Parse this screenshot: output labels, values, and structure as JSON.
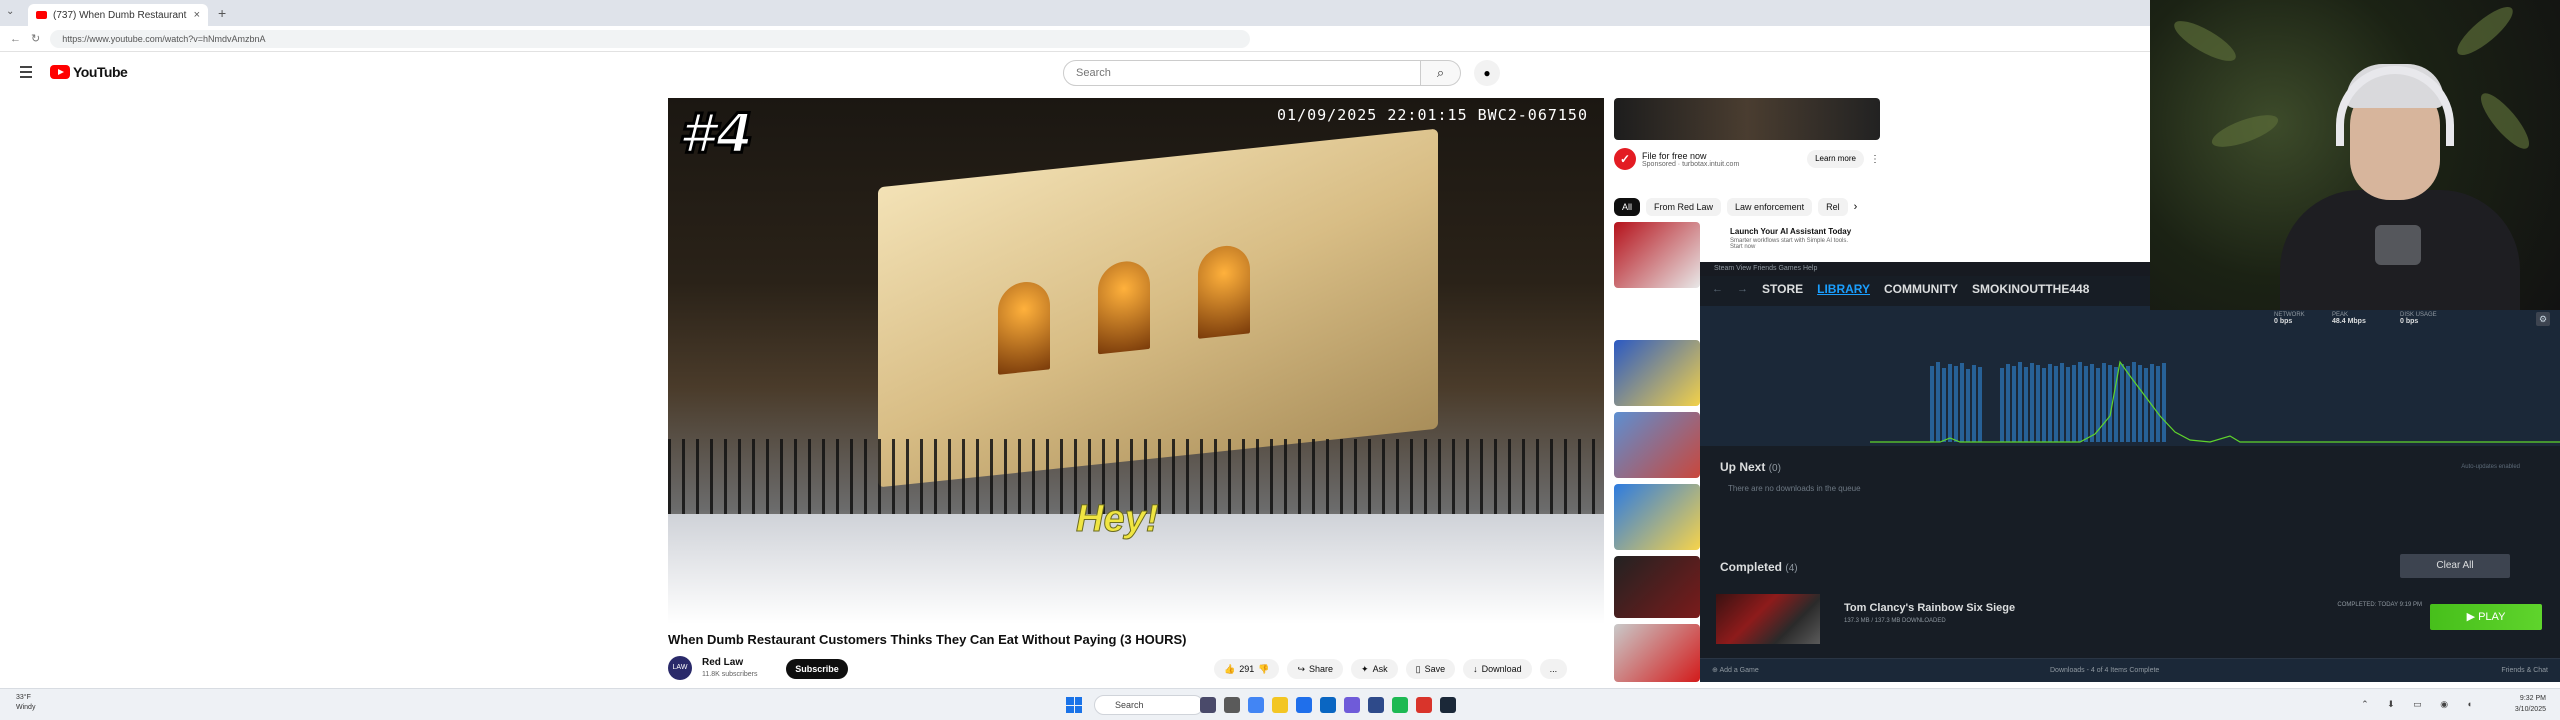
{
  "browser": {
    "tab_title": "(737) When Dumb Restaurant",
    "new_tab": "+",
    "close": "×",
    "url": "https://www.youtube.com/watch?v=hNmdvAmzbnA"
  },
  "youtube": {
    "logo_text": "YouTube",
    "search_placeholder": "Search",
    "video": {
      "overlay_rank": "#4",
      "overlay_timestamp": "01/09/2025 22:01:15   BWC2-067150",
      "overlay_caption": "Hey!",
      "title": "When Dumb Restaurant Customers Thinks They Can Eat Without Paying (3 HOURS)",
      "channel_name": "Red Law",
      "channel_avatar": "LAW",
      "subscribers": "11.8K subscribers",
      "subscribe_label": "Subscribe",
      "like_count": "291",
      "share_label": "Share",
      "ask_label": "Ask",
      "save_label": "Save",
      "download_label": "Download",
      "more_label": "..."
    },
    "ad": {
      "line1": "File for free now",
      "line2": "Sponsored · turbotax.intuit.com",
      "learn_more": "Learn more"
    },
    "chips": [
      "All",
      "From Red Law",
      "Law enforcement",
      "Rel"
    ],
    "sidebar_first": {
      "title": "Launch Your AI Assistant Today",
      "desc": "Smarter workflows start with Simple AI tools. Start now"
    }
  },
  "steam": {
    "menu": "Steam   View   Friends   Games   Help",
    "nav": {
      "store": "STORE",
      "library": "LIBRARY",
      "community": "COMMUNITY",
      "user": "SMOKINOUTTHE448"
    },
    "stats": [
      {
        "label": "NETWORK",
        "value": "0 bps"
      },
      {
        "label": "PEAK",
        "value": "48.4 Mbps"
      },
      {
        "label": "DISK USAGE",
        "value": "0 bps"
      }
    ],
    "up_next_label": "Up Next",
    "up_next_count": "(0)",
    "auto_updates": "Auto-updates enabled",
    "empty_queue": "There are no downloads in the queue",
    "completed_label": "Completed",
    "completed_count": "(4)",
    "clear_all": "Clear All",
    "game": {
      "name": "Tom Clancy's Rainbow Six Siege",
      "size": "137.3 MB / 137.3 MB DOWNLOADED",
      "completed": "COMPLETED: TODAY 9:19 PM",
      "play": "▶ PLAY"
    },
    "footer_left": "Add a Game",
    "footer_mid": "Downloads - 4 of 4 Items Complete",
    "footer_right": "Friends & Chat"
  },
  "taskbar": {
    "weather_temp": "33°F",
    "weather_desc": "Windy",
    "search": "Search",
    "time": "9:32 PM",
    "date": "3/10/2025"
  },
  "colors": {
    "youtube_red": "#ff0000",
    "steam_bg": "#171d25",
    "steam_blue": "#1a9fff",
    "play_green": "#5fd42c"
  }
}
